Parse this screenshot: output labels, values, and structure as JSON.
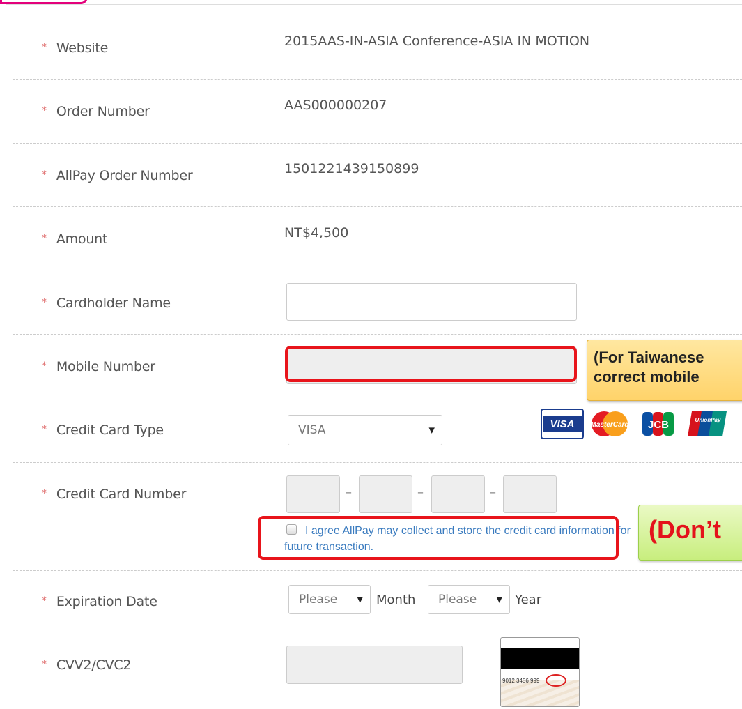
{
  "form": {
    "rows": [
      {
        "label": "Website",
        "value": "2015AAS-IN-ASIA Conference-ASIA IN MOTION"
      },
      {
        "label": "Order Number",
        "value": "AAS000000207"
      },
      {
        "label": "AllPay Order Number",
        "value": "1501221439150899"
      },
      {
        "label": "Amount",
        "value": "NT$4,500"
      },
      {
        "label": "Cardholder Name"
      },
      {
        "label": "Mobile Number"
      },
      {
        "label": "Credit Card Type"
      },
      {
        "label": "Credit Card Number"
      },
      {
        "label": "Expiration Date"
      },
      {
        "label": "CVV2/CVC2"
      }
    ],
    "required_mark": "*",
    "card_type": {
      "selected": "VISA"
    },
    "card_logos": [
      "VISA",
      "MasterCard",
      "JCB",
      "UnionPay"
    ],
    "card_number_separator": "–",
    "agree_text": "I agree AllPay may collect and store the credit card information for future transaction.",
    "expiration": {
      "month_selected": "Please",
      "month_label": "Month",
      "year_selected": "Please",
      "year_label": "Year"
    },
    "cvv_sample_text": "9012 3456 999"
  },
  "annotations": {
    "yellow_line1": "(For Taiwanese",
    "yellow_line2": "correct mobile",
    "green_text": "(Don’t"
  },
  "colors": {
    "highlight": "#e8141b",
    "link_text": "#3a7bbf",
    "yellow_note": "#ffd36a",
    "green_note": "#c8ee7e"
  }
}
